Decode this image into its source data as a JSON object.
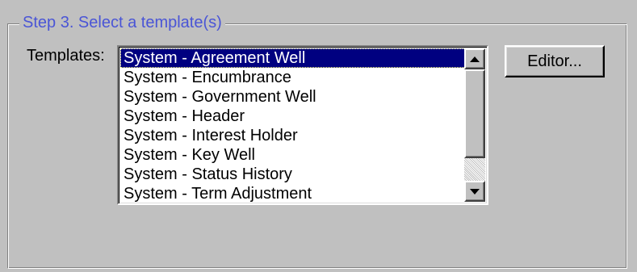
{
  "group": {
    "title": "Step 3.  Select a template(s)"
  },
  "templates": {
    "label": "Templates:",
    "items": [
      "System - Agreement Well",
      "System - Encumbrance",
      "System - Government Well",
      "System - Header",
      "System - Interest Holder",
      "System - Key Well",
      "System - Status History",
      "System - Term Adjustment"
    ],
    "selected_index": 0
  },
  "buttons": {
    "editor_label": "Editor..."
  },
  "icons": {
    "scroll_up": "scroll-up-arrow-icon",
    "scroll_down": "scroll-down-arrow-icon"
  },
  "colors": {
    "window_bg": "#c0c0c0",
    "group_title": "#4a55d6",
    "selection_bg": "#000080",
    "selection_fg": "#ffffff"
  }
}
